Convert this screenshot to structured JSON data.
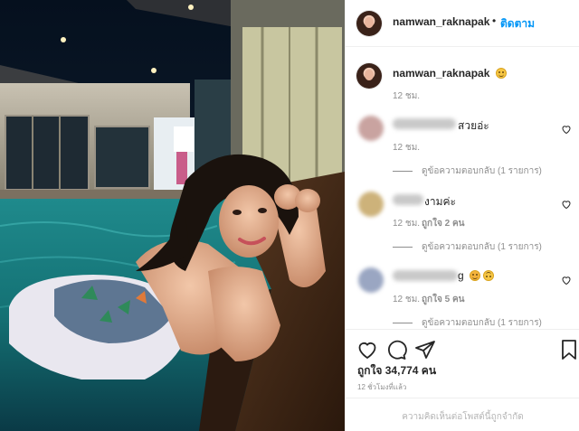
{
  "post": {
    "photo_alt": "",
    "author": {
      "username": "namwan_raknapak",
      "separator": "•",
      "follow_label": "ติดตาม"
    },
    "caption": {
      "username": "namwan_raknapak",
      "emoji": "slightly-smiling-face-emoji",
      "time": "12 ชม."
    },
    "comments": [
      {
        "username_blurred": "(blurred username)",
        "text": "สวยอ่ะ",
        "time": "12 ชม.",
        "likes": "",
        "reply_label": "ดูข้อความตอบกลับ (1 รายการ)"
      },
      {
        "username_blurred": "(blurred username)",
        "text": "งามค่ะ",
        "time": "12 ชม.",
        "likes": "ถูกใจ 2 คน",
        "reply_label": "ดูข้อความตอบกลับ (1 รายการ)"
      },
      {
        "username_blurred": "(blurred username)",
        "text": "g",
        "emojis": [
          "smiling-face-emoji",
          "upside-down-face-emoji"
        ],
        "time": "12 ชม.",
        "likes": "ถูกใจ 5 คน",
        "reply_label": "ดูข้อความตอบกลับ (1 รายการ)"
      }
    ],
    "actions": {
      "like_icon": "heart-icon",
      "comment_icon": "comment-icon",
      "share_icon": "send-icon",
      "save_icon": "bookmark-icon"
    },
    "likes_text": "ถูกใจ 34,774 คน",
    "posted_ago": "12 ชั่วโมงที่แล้ว",
    "comments_disabled": "ความคิดเห็นต่อโพสต์นี้ถูกจำกัด"
  },
  "colors": {
    "link_blue": "#0095f6",
    "text": "#262626",
    "muted": "#8e8e8e",
    "border": "#efefef"
  }
}
